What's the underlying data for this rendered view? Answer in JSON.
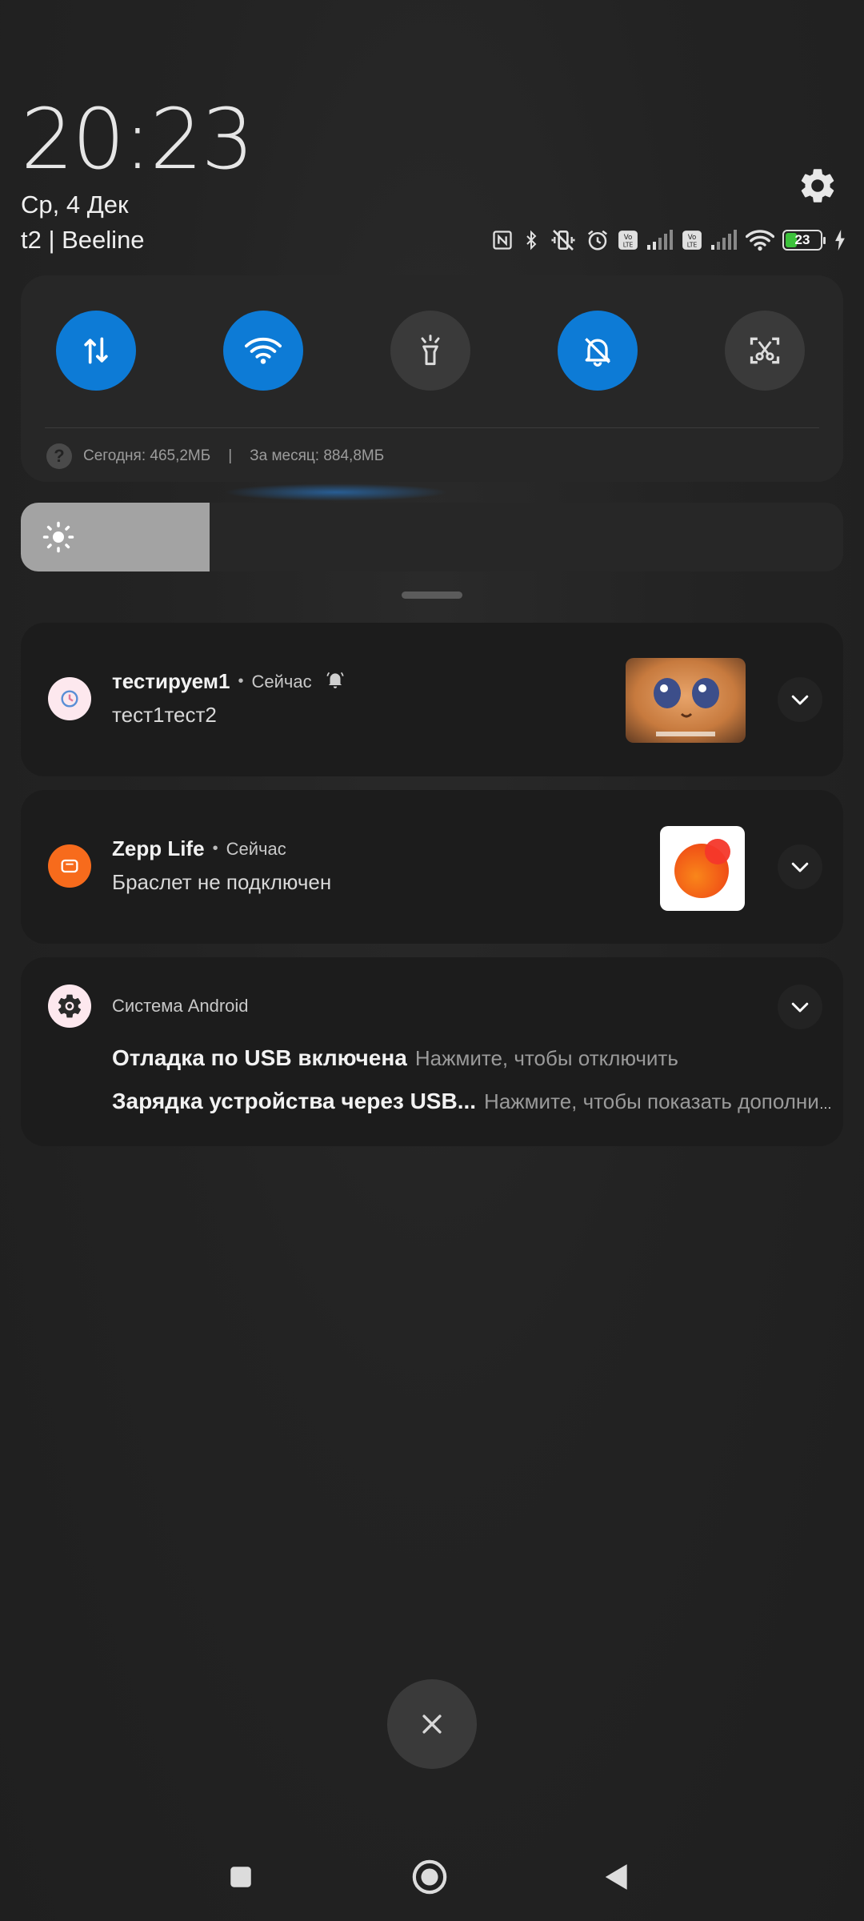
{
  "header": {
    "time": "20:23",
    "date": "Ср, 4 Дек",
    "carrier": "t2 | Beeline",
    "battery_level": "23"
  },
  "status_icons": [
    "nfc-icon",
    "bluetooth-icon",
    "vibrate-off-icon",
    "alarm-icon",
    "volte-icon",
    "signal-icon",
    "volte-icon",
    "signal-icon",
    "wifi-icon",
    "battery-icon",
    "charging-icon"
  ],
  "quick_settings": {
    "tiles": [
      {
        "name": "mobile-data",
        "on": true
      },
      {
        "name": "wifi",
        "on": true
      },
      {
        "name": "flashlight",
        "on": false
      },
      {
        "name": "silent",
        "on": true
      },
      {
        "name": "screenshot",
        "on": false
      }
    ],
    "traffic_today": "Сегодня: 465,2МБ",
    "traffic_separator": "|",
    "traffic_month": "За месяц: 884,8МБ"
  },
  "brightness": {
    "level": 0.23
  },
  "notifications": [
    {
      "app": "тестируем1",
      "dot": "•",
      "time": "Сейчас",
      "text": "тест1тест2",
      "thumb_caption": "..."
    },
    {
      "app": "Zepp Life",
      "dot": "•",
      "time": "Сейчас",
      "text": "Браслет не подключен"
    },
    {
      "app": "Система Android",
      "lines": [
        {
          "title": "Отладка по USB включена",
          "text": "Нажмите, чтобы отключить"
        },
        {
          "title": "Зарядка устройства через USB...",
          "text": "Нажмите, чтобы показать дополнительные параметры"
        }
      ]
    }
  ],
  "colors": {
    "accent": "#0d7bd6",
    "zepp_orange": "#f76b1c",
    "battery_green": "#3cc13b"
  }
}
